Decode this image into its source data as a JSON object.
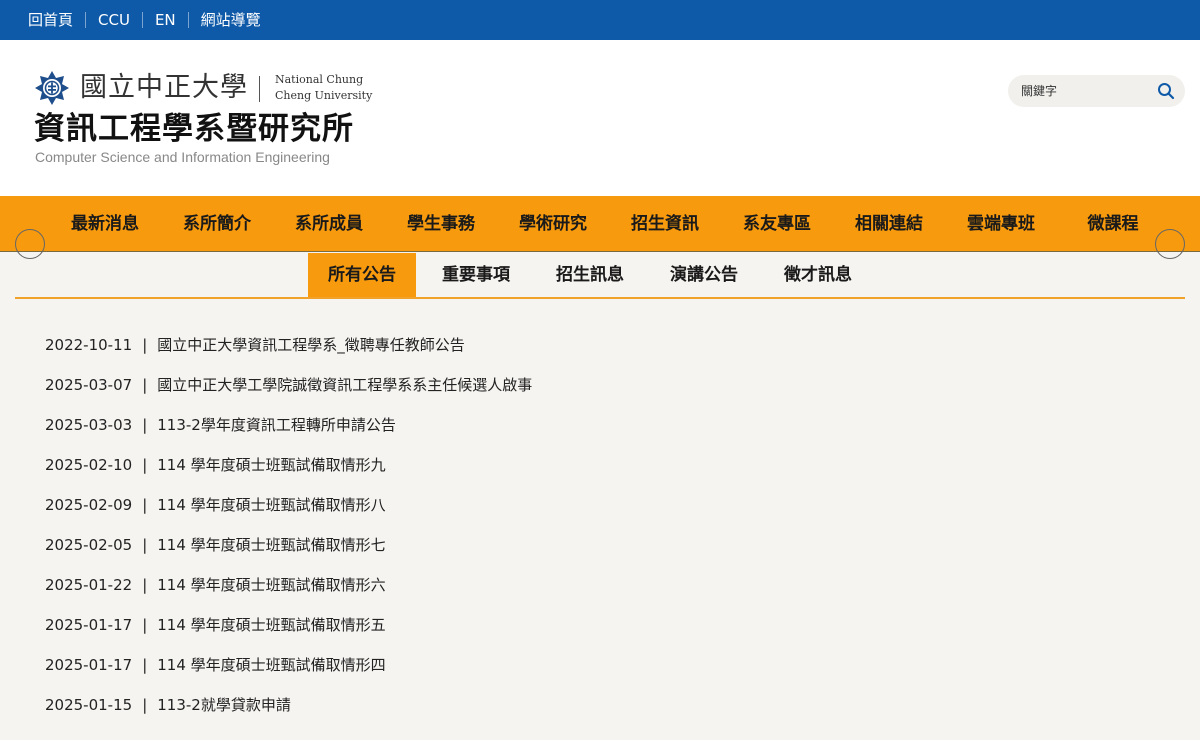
{
  "topbar": {
    "links": [
      "回首頁",
      "CCU",
      "EN",
      "網站導覽"
    ]
  },
  "header": {
    "university_zh": "國立中正大學",
    "university_en": "National Chung\nCheng University",
    "department_zh": "資訊工程學系暨研究所",
    "department_en": "Computer Science and Information Engineering",
    "emblem_icon": "ccu-emblem-icon"
  },
  "search": {
    "placeholder": "關鍵字",
    "button_icon": "search-icon"
  },
  "main_nav": {
    "items": [
      "最新消息",
      "系所簡介",
      "系所成員",
      "學生事務",
      "學術研究",
      "招生資訊",
      "系友專區",
      "相關連結",
      "雲端專班",
      "微課程"
    ]
  },
  "sub_tabs": {
    "items": [
      "所有公告",
      "重要事項",
      "招生訊息",
      "演講公告",
      "徵才訊息"
    ],
    "active": "所有公告"
  },
  "separator": "|",
  "news": [
    {
      "date": "2022-10-11",
      "title": "國立中正大學資訊工程學系_徵聘專任教師公告"
    },
    {
      "date": "2025-03-07",
      "title": "國立中正大學工學院誠徵資訊工程學系系主任候選人啟事"
    },
    {
      "date": "2025-03-03",
      "title": "113-2學年度資訊工程轉所申請公告"
    },
    {
      "date": "2025-02-10",
      "title": "114 學年度碩士班甄試備取情形九"
    },
    {
      "date": "2025-02-09",
      "title": "114 學年度碩士班甄試備取情形八"
    },
    {
      "date": "2025-02-05",
      "title": "114 學年度碩士班甄試備取情形七"
    },
    {
      "date": "2025-01-22",
      "title": "114 學年度碩士班甄試備取情形六"
    },
    {
      "date": "2025-01-17",
      "title": "114 學年度碩士班甄試備取情形五"
    },
    {
      "date": "2025-01-17",
      "title": "114 學年度碩士班甄試備取情形四"
    },
    {
      "date": "2025-01-15",
      "title": "113-2就學貸款申請"
    }
  ],
  "colors": {
    "topbar": "#0f5aa8",
    "nav": "#f79a0d",
    "background": "#f5f4f1"
  }
}
